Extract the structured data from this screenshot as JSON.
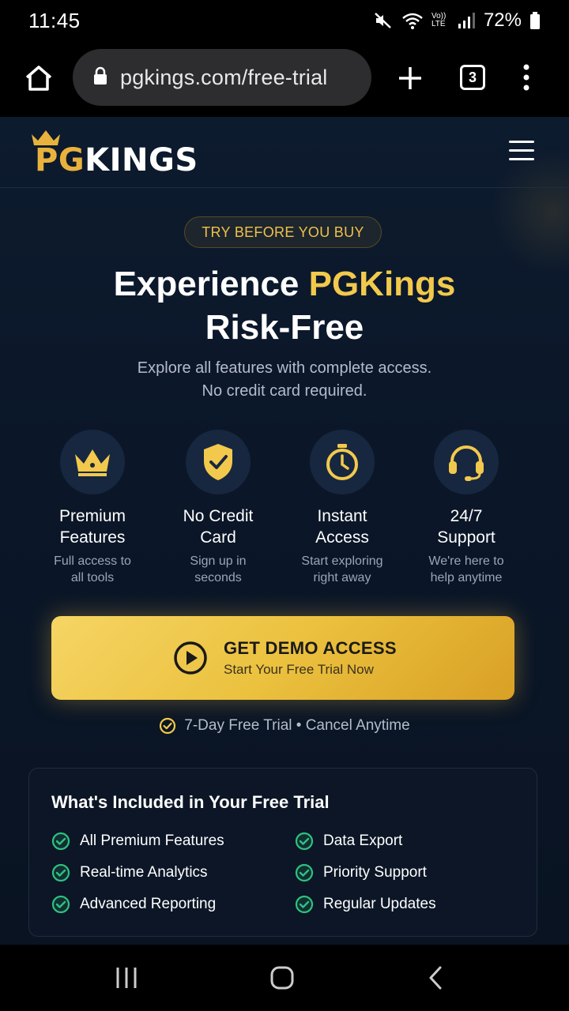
{
  "status_bar": {
    "time": "11:45",
    "network_label": "Vo)) LTE",
    "battery": "72%"
  },
  "browser": {
    "url": "pgkings.com/free-trial",
    "tab_count": "3"
  },
  "site": {
    "logo_pg": "PG",
    "logo_kings": "KINGS"
  },
  "hero": {
    "badge": "TRY BEFORE YOU BUY",
    "title_part1": "Experience ",
    "title_accent": "PGKings",
    "title_part2": "Risk-Free",
    "subtitle_line1": "Explore all features with complete access.",
    "subtitle_line2": "No credit card required."
  },
  "features": [
    {
      "icon": "crown-icon",
      "title1": "Premium",
      "title2": "Features",
      "desc1": "Full access to",
      "desc2": "all tools"
    },
    {
      "icon": "shield-check-icon",
      "title1": "No Credit",
      "title2": "Card",
      "desc1": "Sign up in",
      "desc2": "seconds"
    },
    {
      "icon": "stopwatch-icon",
      "title1": "Instant",
      "title2": "Access",
      "desc1": "Start exploring",
      "desc2": "right away"
    },
    {
      "icon": "headset-icon",
      "title1": "24/7",
      "title2": "Support",
      "desc1": "We're here to",
      "desc2": "help anytime"
    }
  ],
  "cta": {
    "title": "GET DEMO ACCESS",
    "subtitle": "Start Your Free Trial Now"
  },
  "trial_note": "7-Day Free Trial • Cancel Anytime",
  "included": {
    "title": "What's Included in Your Free Trial",
    "items": [
      "All Premium Features",
      "Data Export",
      "Real-time Analytics",
      "Priority Support",
      "Advanced Reporting",
      "Regular Updates"
    ]
  },
  "colors": {
    "accent_gold": "#f2c94c",
    "page_bg": "#0d1b2e",
    "check_green": "#2ec27e"
  }
}
